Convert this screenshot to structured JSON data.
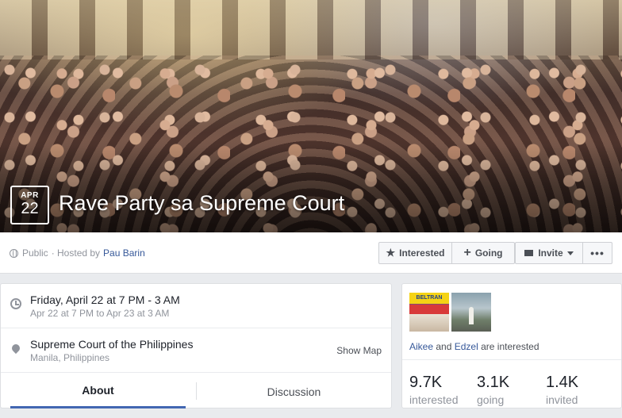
{
  "event": {
    "month": "APR",
    "day": "22",
    "title": "Rave Party sa Supreme Court"
  },
  "header": {
    "privacy": "Public",
    "hosted_by_prefix": "· Hosted by",
    "host": "Pau Barin",
    "interested_label": "Interested",
    "going_label": "Going",
    "invite_label": "Invite",
    "more_label": "•••"
  },
  "details": {
    "time_main": "Friday, April 22 at 7 PM - 3 AM",
    "time_sub": "Apr 22 at 7 PM to Apr 23 at 3 AM",
    "place_main": "Supreme Court of the Philippines",
    "place_sub": "Manila, Philippines",
    "show_map": "Show Map"
  },
  "tabs": [
    {
      "label": "About"
    },
    {
      "label": "Discussion"
    }
  ],
  "social": {
    "thumb1_text": "BELTRAN",
    "name1": "Aikee",
    "and": "and",
    "name2": "Edzel",
    "suffix": "are interested"
  },
  "stats": [
    {
      "value": "9.7K",
      "label": "interested"
    },
    {
      "value": "3.1K",
      "label": "going"
    },
    {
      "value": "1.4K",
      "label": "invited"
    }
  ],
  "colors": {
    "link": "#365899",
    "accent": "#4267b2"
  }
}
